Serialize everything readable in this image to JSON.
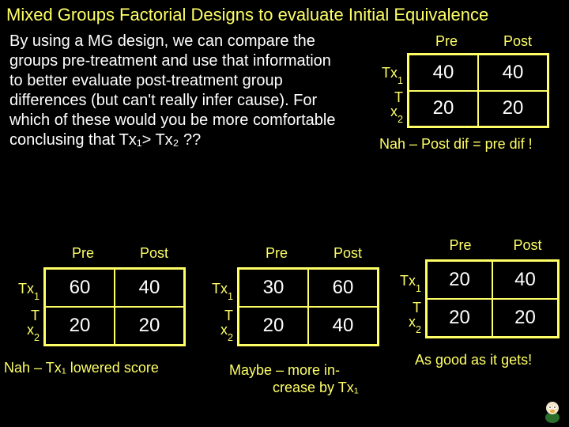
{
  "title": "Mixed Groups Factorial Designs to evaluate Initial Equivalence",
  "body_text": "By using a MG design, we can compare the groups pre-treatment and use that information to better evaluate post-treatment group differences (but can't really infer cause).  For which of these would you be more comfortable conclusing that Tx₁> Tx₂ ??",
  "tables": {
    "top_right": {
      "hdr_pre": "Pre",
      "hdr_post": "Post",
      "row1_label_a": "Tx",
      "row1_label_sub": "1",
      "row2_label_top": "T",
      "row2_label_a": "x",
      "row2_label_sub": "2",
      "c11": "40",
      "c12": "40",
      "c21": "20",
      "c22": "20",
      "caption": "Nah – Post dif = pre dif !"
    },
    "bottom_left": {
      "hdr_pre": "Pre",
      "hdr_post": "Post",
      "row1_label_a": "Tx",
      "row1_label_sub": "1",
      "row2_label_top": "T",
      "row2_label_a": "x",
      "row2_label_sub": "2",
      "c11": "60",
      "c12": "40",
      "c21": "20",
      "c22": "20",
      "caption": "Nah – Tx₁ lowered score"
    },
    "bottom_mid": {
      "hdr_pre": "Pre",
      "hdr_post": "Post",
      "row1_label_a": "Tx",
      "row1_label_sub": "1",
      "row2_label_top": "T",
      "row2_label_a": "x",
      "row2_label_sub": "2",
      "c11": "30",
      "c12": "60",
      "c21": "20",
      "c22": "40",
      "caption_line1": "Maybe – more  in-",
      "caption_line2": "crease by Tx₁"
    },
    "bottom_right": {
      "hdr_pre": "Pre",
      "hdr_post": "Post",
      "row1_label_a": "Tx",
      "row1_label_sub": "1",
      "row2_label_top": "T",
      "row2_label_a": "x",
      "row2_label_sub": "2",
      "c11": "20",
      "c12": "40",
      "c21": "20",
      "c22": "20",
      "caption": "As good as it gets!"
    }
  },
  "chart_data": [
    {
      "type": "table",
      "name": "top_right",
      "row_labels": [
        "Tx1",
        "Tx2"
      ],
      "col_labels": [
        "Pre",
        "Post"
      ],
      "values": [
        [
          40,
          40
        ],
        [
          20,
          20
        ]
      ],
      "caption": "Nah – Post dif = pre dif !"
    },
    {
      "type": "table",
      "name": "bottom_left",
      "row_labels": [
        "Tx1",
        "Tx2"
      ],
      "col_labels": [
        "Pre",
        "Post"
      ],
      "values": [
        [
          60,
          40
        ],
        [
          20,
          20
        ]
      ],
      "caption": "Nah – Tx1 lowered score"
    },
    {
      "type": "table",
      "name": "bottom_mid",
      "row_labels": [
        "Tx1",
        "Tx2"
      ],
      "col_labels": [
        "Pre",
        "Post"
      ],
      "values": [
        [
          30,
          60
        ],
        [
          20,
          40
        ]
      ],
      "caption": "Maybe – more increase by Tx1"
    },
    {
      "type": "table",
      "name": "bottom_right",
      "row_labels": [
        "Tx1",
        "Tx2"
      ],
      "col_labels": [
        "Pre",
        "Post"
      ],
      "values": [
        [
          20,
          40
        ],
        [
          20,
          20
        ]
      ],
      "caption": "As good as it gets!"
    }
  ]
}
